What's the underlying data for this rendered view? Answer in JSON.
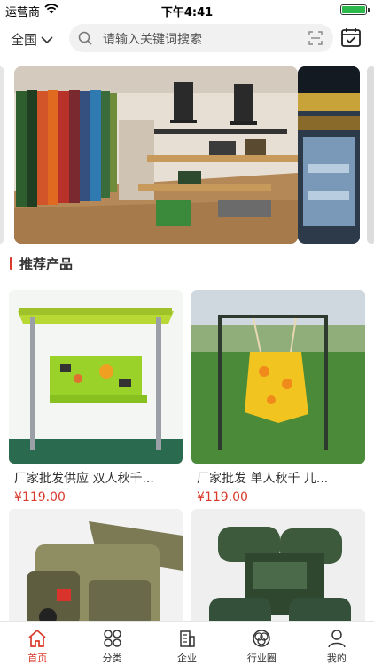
{
  "status_bar": {
    "carrier": "运营商",
    "time": "下午4:41"
  },
  "header": {
    "city": "全国",
    "search_placeholder": "请输入关键词搜索"
  },
  "section": {
    "title": "推荐产品"
  },
  "products": [
    {
      "name": "厂家批发供应 双人秋千...",
      "price": "¥119.00"
    },
    {
      "name": "厂家批发 单人秋千 儿...",
      "price": "¥119.00"
    },
    {
      "name": "",
      "price": ""
    },
    {
      "name": "",
      "price": ""
    }
  ],
  "tabbar": {
    "items": [
      {
        "label": "首页",
        "icon": "home-icon",
        "active": true
      },
      {
        "label": "分类",
        "icon": "category-icon",
        "active": false
      },
      {
        "label": "企业",
        "icon": "building-icon",
        "active": false
      },
      {
        "label": "行业圈",
        "icon": "circles-icon",
        "active": false
      },
      {
        "label": "我的",
        "icon": "user-icon",
        "active": false
      }
    ]
  },
  "colors": {
    "accent": "#d93a2b",
    "battery": "#2db84b"
  }
}
